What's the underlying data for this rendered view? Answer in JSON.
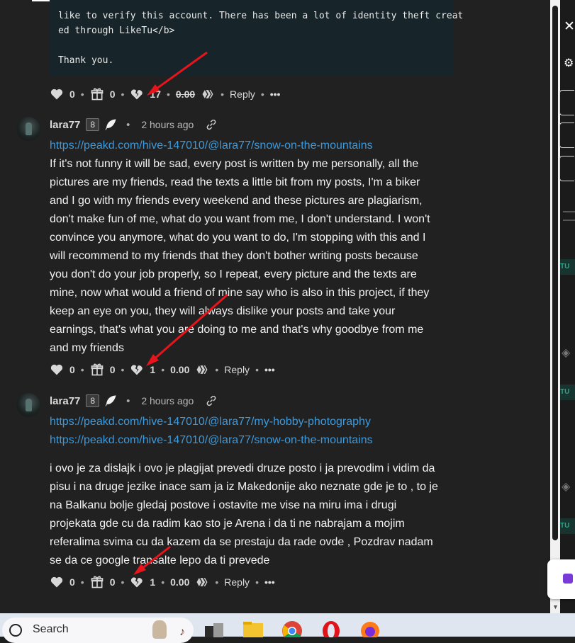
{
  "post": {
    "code_lines": [
      "like to verify this account. There has been a lot of identity theft creat",
      "ed through LikeTu</b>",
      "",
      "Thank you."
    ],
    "actions": {
      "likes": "0",
      "gifts": "0",
      "votes": "17",
      "payout": "0.00",
      "reply": "Reply",
      "more": "•••"
    }
  },
  "comments": [
    {
      "username": "lara77",
      "reputation": "8",
      "time": "2 hours ago",
      "links": [
        "https://peakd.com/hive-147010/@lara77/snow-on-the-mountains"
      ],
      "body_lines": [
        "If it's not funny it will be sad, every post is written by me personally, all the",
        "pictures are my friends, read the texts a little bit from my posts, I'm a biker",
        "and I go with my friends every weekend and these pictures are plagiarism,",
        "don't make fun of me, what do you want from me, I don't understand. I won't",
        "convince you anymore, what do you want to do, I'm stopping with this and I",
        "will recommend to my friends that they don't bother writing posts because",
        "you don't do your job properly, so I repeat, every picture and the texts are",
        "mine, now what would a friend of mine say who is also in this project, if they",
        "keep an eye on you, they will always dislike your posts and take your",
        "earnings, that's what you are doing to me and that's why goodbye from me",
        "and my friends"
      ],
      "actions": {
        "likes": "0",
        "gifts": "0",
        "votes": "1",
        "payout": "0.00",
        "reply": "Reply",
        "more": "•••"
      }
    },
    {
      "username": "lara77",
      "reputation": "8",
      "time": "2 hours ago",
      "links": [
        "https://peakd.com/hive-147010/@lara77/my-hobby-photography",
        "https://peakd.com/hive-147010/@lara77/snow-on-the-mountains"
      ],
      "body_lines": [
        "i ovo je za dislajk i ovo je plagijat prevedi druze posto i ja prevodim i vidim da",
        "pisu i na druge jezike inace sam ja iz Makedonije ako neznate gde je to , to je",
        "na Balkanu bolje gledaj postove i ostavite me vise na miru ima i drugi",
        "projekata gde cu da radim kao sto je Arena i da ti ne nabrajam a mojim",
        "referalima svima cu da kazem da se prestaju da rade ovde , Pozdrav nadam",
        "se da ce google transalte lepo da ti prevede"
      ],
      "actions": {
        "likes": "0",
        "gifts": "0",
        "votes": "1",
        "payout": "0.00",
        "reply": "Reply",
        "more": "•••"
      }
    }
  ],
  "side_panel": {
    "badge_1": "TU",
    "badge_2": "TU",
    "badge_3": "TU"
  },
  "taskbar": {
    "search_placeholder": "Search"
  },
  "colors": {
    "link": "#3b9ade",
    "arrow": "#e8141c",
    "background": "#212121",
    "code_bg": "#17252a"
  }
}
